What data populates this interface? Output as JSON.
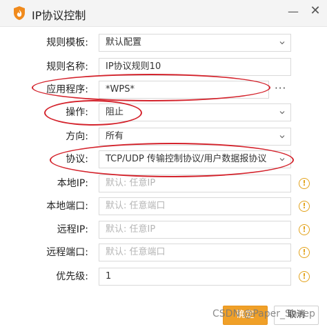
{
  "window": {
    "title": "IP协议控制",
    "minimize_glyph": "—",
    "close_glyph": "✕",
    "icon": "flame-shield-icon"
  },
  "form": {
    "rule_template": {
      "label": "规则模板:",
      "value": "默认配置"
    },
    "rule_name": {
      "label": "规则名称:",
      "value": "IP协议规则10"
    },
    "application": {
      "label": "应用程序:",
      "value": "*WPS*",
      "browse_glyph": "···"
    },
    "action": {
      "label": "操作:",
      "value": "阻止"
    },
    "direction": {
      "label": "方向:",
      "value": "所有"
    },
    "protocol": {
      "label": "协议:",
      "value": "TCP/UDP 传输控制协议/用户数据报协议"
    },
    "local_ip": {
      "label": "本地IP:",
      "placeholder": "默认: 任意IP"
    },
    "local_port": {
      "label": "本地端口:",
      "placeholder": "默认: 任意端口"
    },
    "remote_ip": {
      "label": "远程IP:",
      "placeholder": "默认: 任意IP"
    },
    "remote_port": {
      "label": "远程端口:",
      "placeholder": "默认: 任意端口"
    },
    "priority": {
      "label": "优先级:",
      "value": "1"
    },
    "warn_glyph": "!"
  },
  "footer": {
    "ok_label": "确定",
    "cancel_label": "取消"
  },
  "watermark": "CSDN @Paper_Sheep",
  "colors": {
    "accent": "#f0a028",
    "warning": "#e3a21a",
    "annotation_red": "#d4232c"
  }
}
